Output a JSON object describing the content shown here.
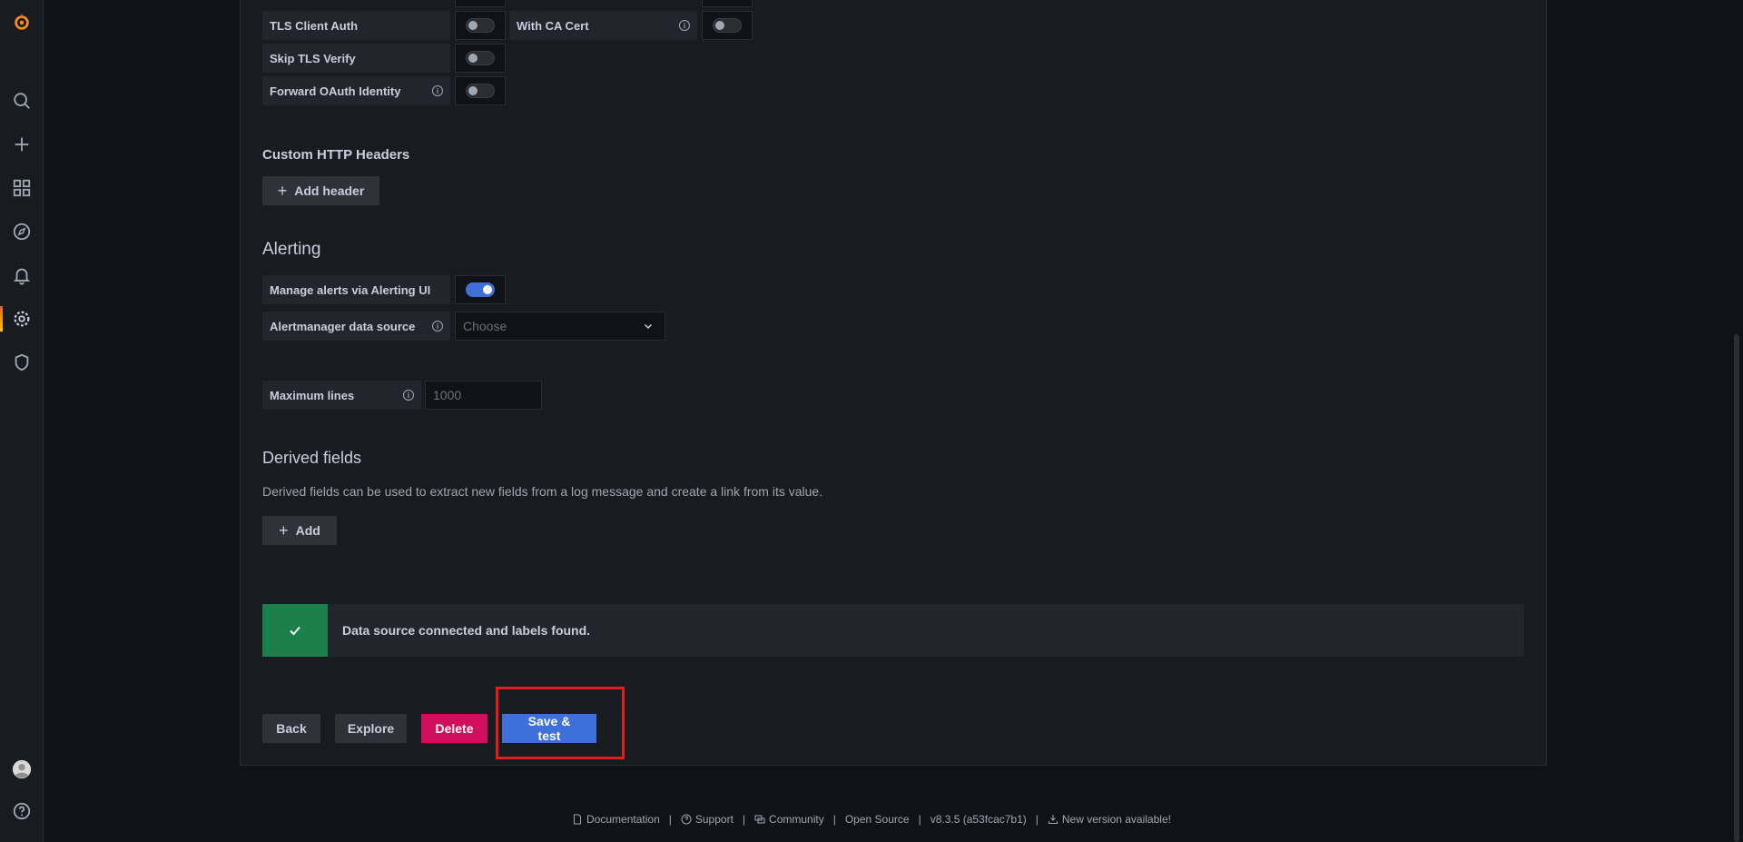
{
  "settings": {
    "tls_client_auth": "TLS Client Auth",
    "with_ca_cert": "With CA Cert",
    "skip_tls_verify": "Skip TLS Verify",
    "forward_oauth": "Forward OAuth Identity"
  },
  "custom_headers": {
    "title": "Custom HTTP Headers",
    "add_button": "Add header"
  },
  "alerting": {
    "title": "Alerting",
    "manage_label": "Manage alerts via Alerting UI",
    "manage_enabled": true,
    "alertmanager_label": "Alertmanager data source",
    "alertmanager_placeholder": "Choose"
  },
  "max_lines": {
    "label": "Maximum lines",
    "placeholder": "1000"
  },
  "derived": {
    "title": "Derived fields",
    "description": "Derived fields can be used to extract new fields from a log message and create a link from its value.",
    "add_button": "Add"
  },
  "status": {
    "message": "Data source connected and labels found.",
    "color": "#1a7f4b"
  },
  "actions": {
    "back": "Back",
    "explore": "Explore",
    "delete": "Delete",
    "save_test": "Save & test"
  },
  "footer": {
    "documentation": "Documentation",
    "support": "Support",
    "community": "Community",
    "open_source": "Open Source",
    "version": "v8.3.5 (a53fcac7b1)",
    "new_version": "New version available!"
  },
  "sidebar": {
    "icons": [
      "grafana-logo",
      "search-icon",
      "plus-icon",
      "dashboards-icon",
      "explore-icon",
      "alerting-icon",
      "configuration-icon",
      "shield-icon",
      "avatar",
      "help-icon"
    ]
  }
}
